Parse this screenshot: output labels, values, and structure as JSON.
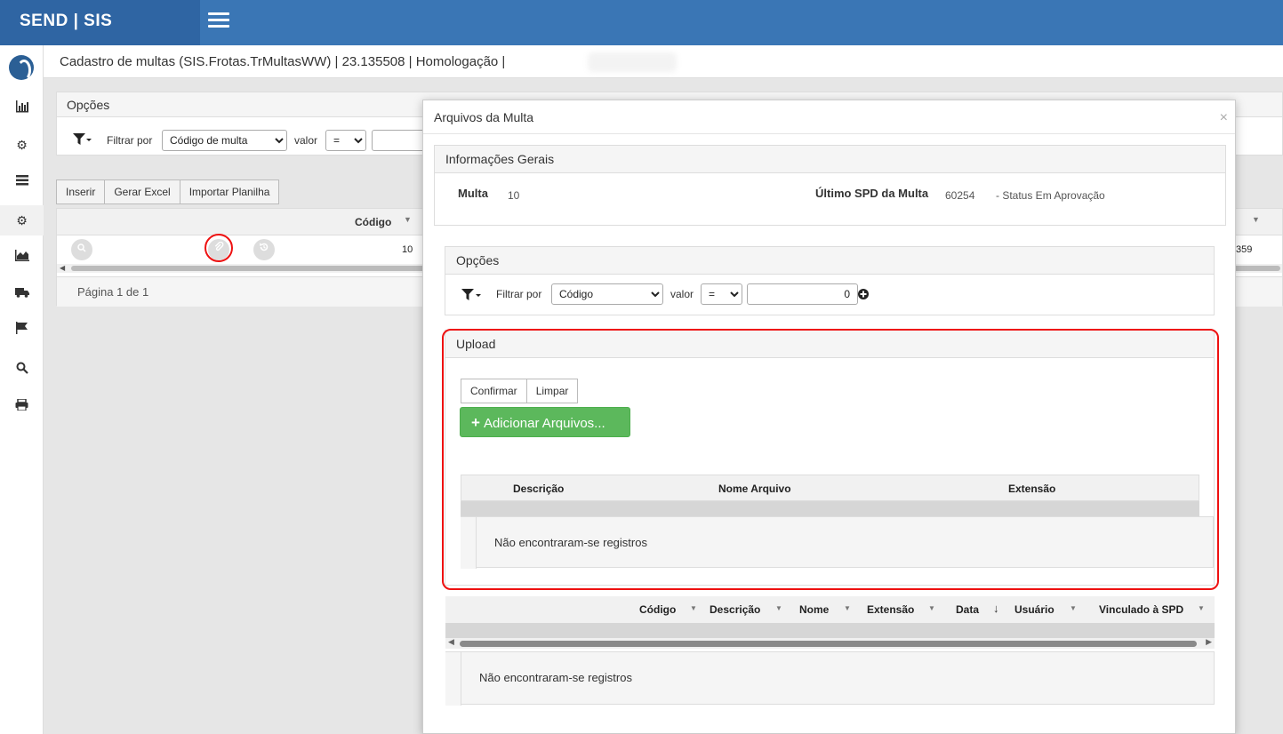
{
  "app": {
    "brand": "SEND | SIS"
  },
  "header": {
    "title": "Cadastro de multas (SIS.Frotas.TrMultasWW) | 23.135508 | Homologação |"
  },
  "sidebar": {
    "icons": [
      "logo-icon",
      "bar-chart-icon",
      "gear-icon",
      "list-icon",
      "gears-icon",
      "area-chart-icon",
      "truck-icon",
      "flag-icon",
      "search-icon",
      "print-icon"
    ]
  },
  "background": {
    "opcoes_title": "Opções",
    "filtrar_por": "Filtrar por",
    "filter_field": "Código de multa",
    "valor": "valor",
    "operator": "=",
    "buttons": {
      "inserir": "Inserir",
      "gerar_excel": "Gerar Excel",
      "importar": "Importar Planilha"
    },
    "grid": {
      "col_codigo": "Código",
      "row_codigo": "10",
      "row_right": "359"
    },
    "pager": "Página 1 de 1"
  },
  "modal": {
    "title": "Arquivos da Multa",
    "close": "×",
    "info": {
      "title": "Informações Gerais",
      "multa_label": "Multa",
      "multa_value": "10",
      "spd_label": "Último SPD da Multa",
      "spd_value": "60254",
      "status": "- Status Em Aprovação"
    },
    "opcoes": {
      "title": "Opções",
      "filtrar_por": "Filtrar por",
      "field": "Código",
      "valor": "valor",
      "operator": "=",
      "value": "0"
    },
    "upload": {
      "title": "Upload",
      "confirmar": "Confirmar",
      "limpar": "Limpar",
      "adicionar": "Adicionar Arquivos...",
      "cols": {
        "descricao": "Descrição",
        "nome": "Nome Arquivo",
        "extensao": "Extensão"
      },
      "empty": "Não encontraram-se registros"
    },
    "files": {
      "cols": {
        "codigo": "Código",
        "descricao": "Descrição",
        "nome": "Nome",
        "extensao": "Extensão",
        "data": "Data",
        "usuario": "Usuário",
        "vinculado": "Vinculado à SPD"
      },
      "empty": "Não encontraram-se registros"
    }
  },
  "colors": {
    "topbar": "#3a76b5",
    "brand": "#2f65a3",
    "highlight": "#e11111",
    "green": "#5cb85c"
  }
}
